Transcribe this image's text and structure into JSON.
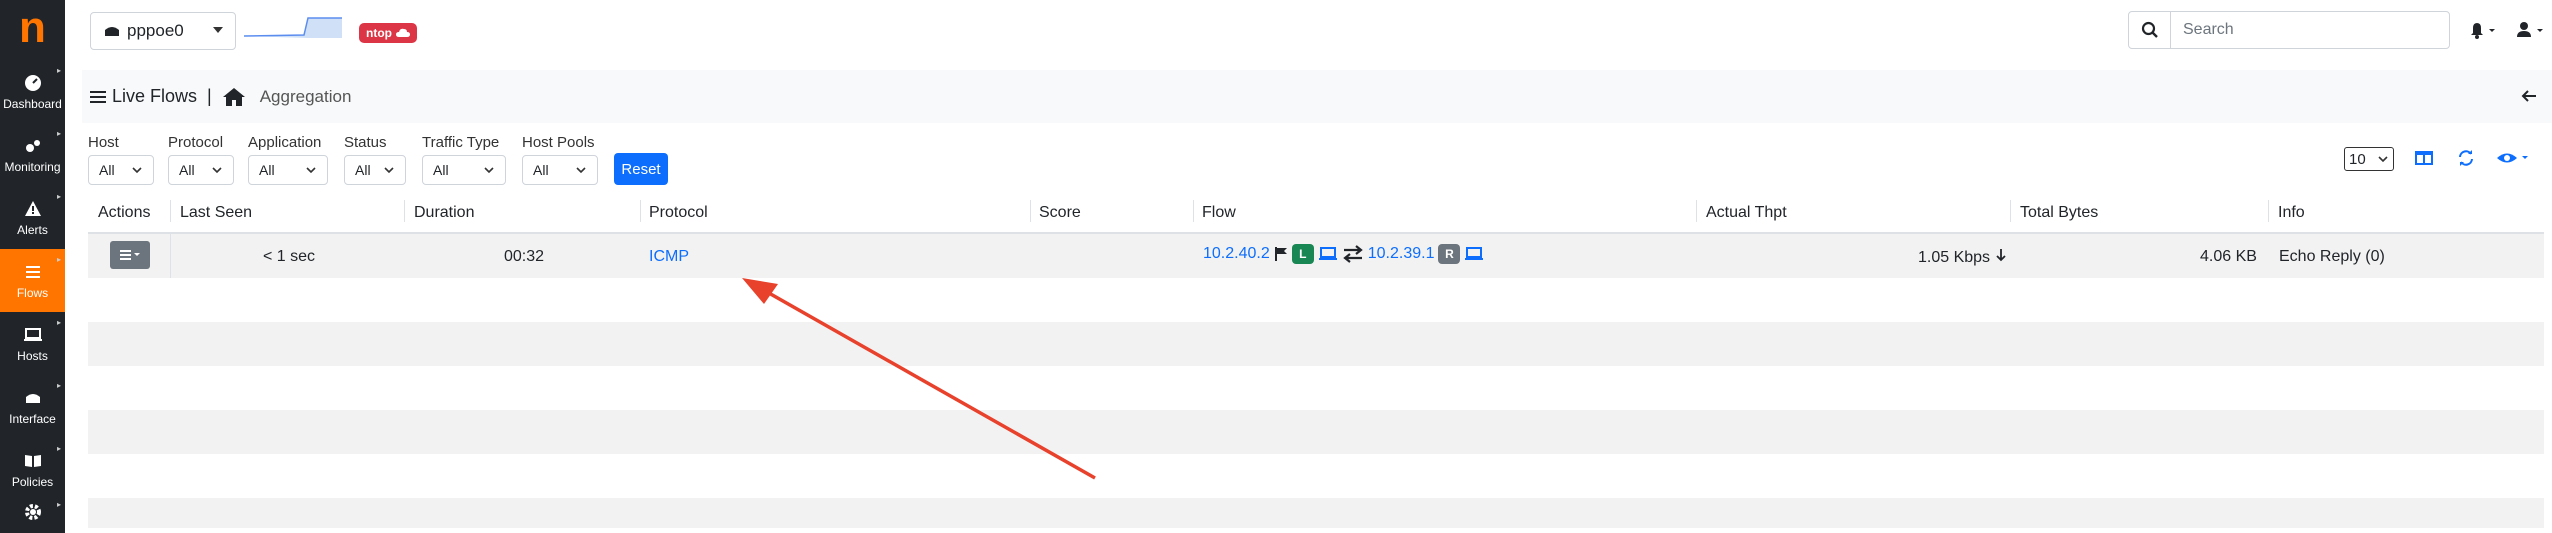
{
  "sidebar": {
    "logo": "n",
    "items": [
      {
        "label": "Dashboard",
        "icon": "gauge-icon"
      },
      {
        "label": "Monitoring",
        "icon": "monitoring-icon"
      },
      {
        "label": "Alerts",
        "icon": "warning-icon"
      },
      {
        "label": "Flows",
        "icon": "list-icon",
        "active": true
      },
      {
        "label": "Hosts",
        "icon": "laptop-icon"
      },
      {
        "label": "Interface",
        "icon": "ethernet-icon"
      },
      {
        "label": "Policies",
        "icon": "book-icon"
      },
      {
        "label": "",
        "icon": "gear-icon"
      }
    ]
  },
  "topbar": {
    "interface": "pppoe0",
    "ntop_badge": "ntop",
    "search_placeholder": "Search"
  },
  "breadcrumb": {
    "title": "Live Flows",
    "separator": "|",
    "section": "Aggregation"
  },
  "filters": [
    {
      "label": "Host",
      "value": "All"
    },
    {
      "label": "Protocol",
      "value": "All"
    },
    {
      "label": "Application",
      "value": "All"
    },
    {
      "label": "Status",
      "value": "All"
    },
    {
      "label": "Traffic Type",
      "value": "All"
    },
    {
      "label": "Host Pools",
      "value": "All"
    }
  ],
  "reset_label": "Reset",
  "per_page": "10",
  "table": {
    "columns": [
      "Actions",
      "Last Seen",
      "Duration",
      "Protocol",
      "Score",
      "Flow",
      "Actual Thpt",
      "Total Bytes",
      "Info"
    ],
    "rows": [
      {
        "last_seen": "< 1 sec",
        "duration": "00:32",
        "protocol": "ICMP",
        "score": "",
        "flow_src": "10.2.40.2",
        "flow_src_badge": "L",
        "flow_dst": "10.2.39.1",
        "flow_dst_badge": "R",
        "thpt": "1.05 Kbps",
        "total_bytes": "4.06 KB",
        "info": "Echo Reply (0)"
      }
    ]
  },
  "colors": {
    "sidebar_bg": "#212529",
    "accent": "#ff7500",
    "link": "#0d6efd",
    "annotation_arrow": "#e8412c"
  }
}
